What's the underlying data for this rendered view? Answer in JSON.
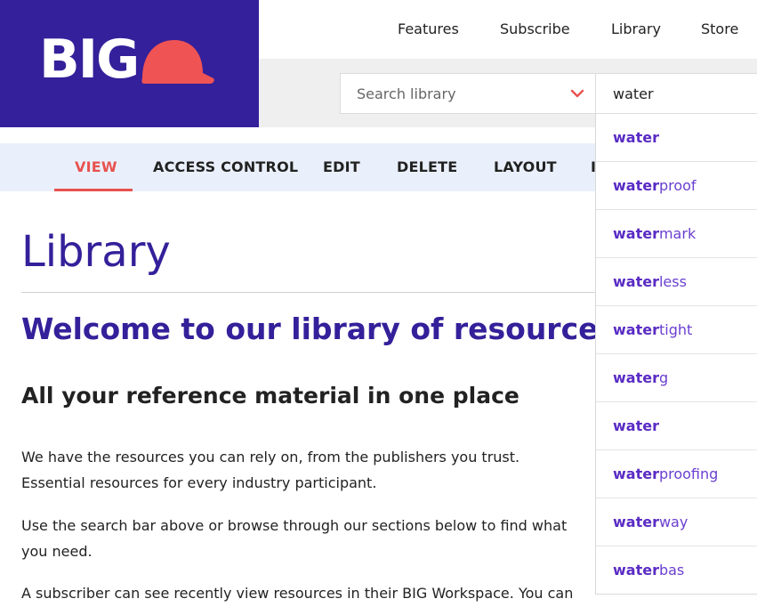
{
  "logo": {
    "text": "BIG",
    "helmet_color": "#ef5353",
    "bg_color": "#34209a"
  },
  "topnav": {
    "items": [
      "Features",
      "Subscribe",
      "Library",
      "Store"
    ]
  },
  "search": {
    "select_placeholder": "Search library",
    "query": "water"
  },
  "tabs": {
    "items": [
      "VIEW",
      "ACCESS CONTROL",
      "EDIT",
      "DELETE",
      "LAYOUT",
      "I"
    ],
    "active": "VIEW",
    "active_color": "#e8524f"
  },
  "content": {
    "title": "Library",
    "welcome": "Welcome to our library of resources for th",
    "subheading": "All your reference material in one place",
    "paragraphs": [
      [
        "We have the resources you can rely on, from the publishers you trust.",
        "Essential resources for every industry participant."
      ],
      [
        "Use the search bar above or browse through our sections below to find what",
        "you need."
      ],
      [
        "A subscriber can see recently view resources in their BIG Workspace. You can"
      ]
    ]
  },
  "suggestions": [
    {
      "match": "water",
      "rest": ""
    },
    {
      "match": "water",
      "rest": "proof"
    },
    {
      "match": "water",
      "rest": "mark"
    },
    {
      "match": "water",
      "rest": "less"
    },
    {
      "match": "water",
      "rest": "tight"
    },
    {
      "match": "water",
      "rest": "g"
    },
    {
      "match": "water",
      "rest": ""
    },
    {
      "match": "water",
      "rest": "proofing"
    },
    {
      "match": "water",
      "rest": "way"
    },
    {
      "match": "water",
      "rest": "bas"
    }
  ],
  "colors": {
    "brand_purple": "#34209a",
    "suggestion_purple": "#6a3fd0",
    "accent_red": "#e8524f"
  }
}
